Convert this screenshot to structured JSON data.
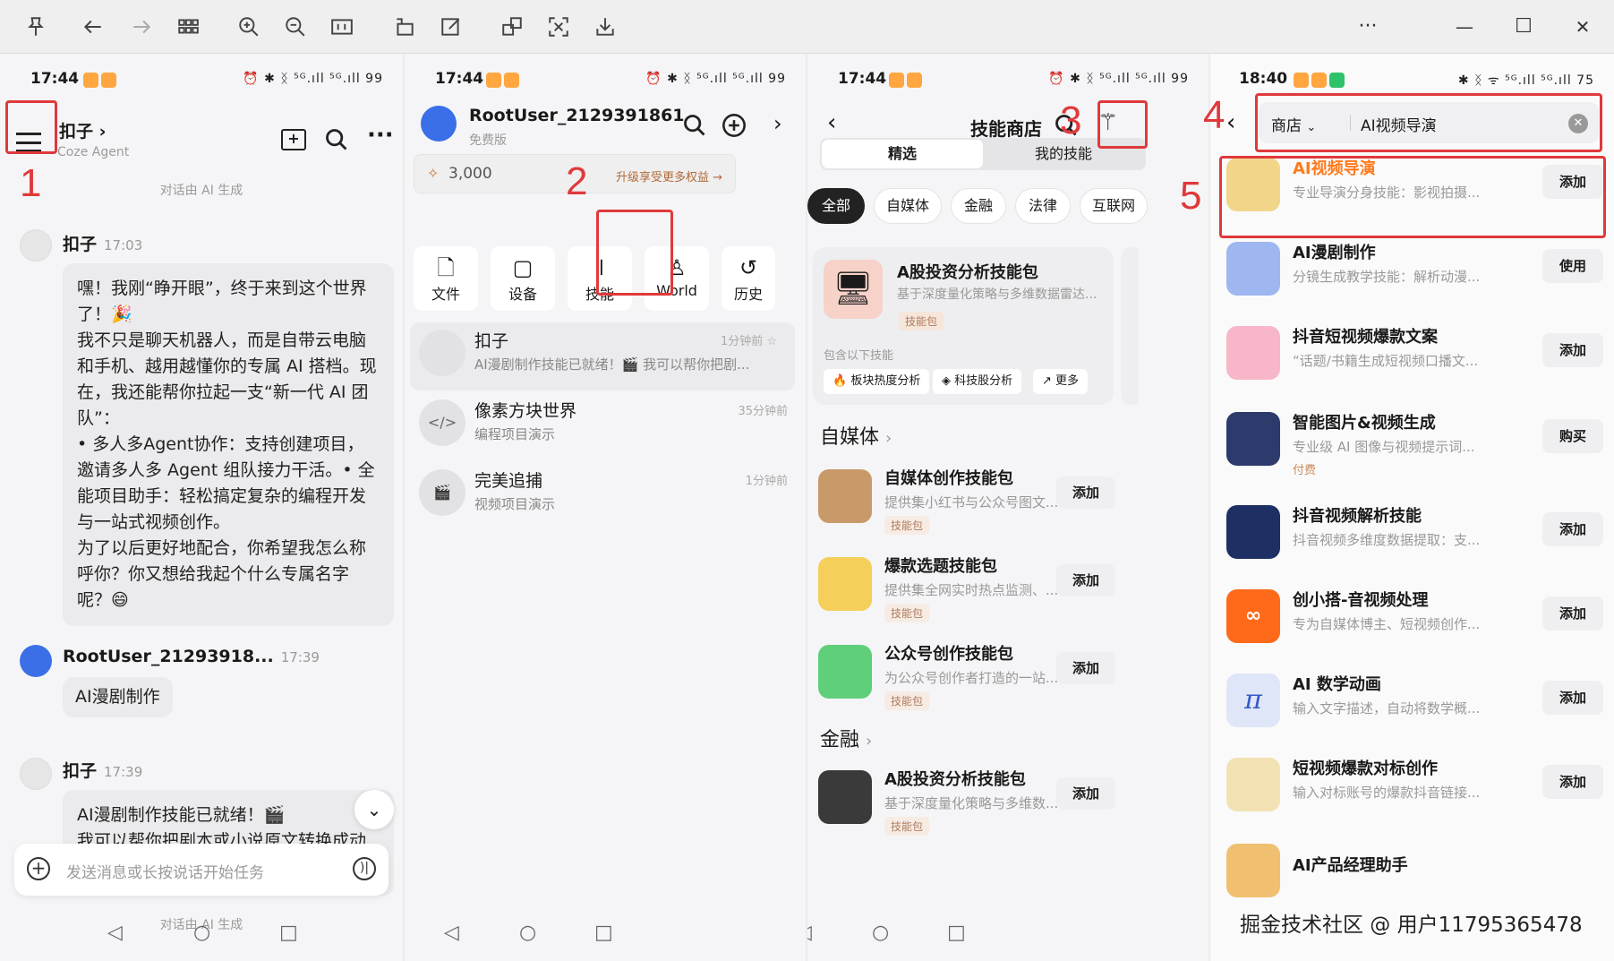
{
  "toolbar": {
    "more": "···",
    "min": "—",
    "max": "☐",
    "close": "✕"
  },
  "step_labels": [
    "1",
    "2",
    "3",
    "4",
    "5"
  ],
  "p1": {
    "time": "17:44",
    "status_icons": "⏰ ✱ ᛝ ⁵ᴳ.ıll ⁵ᴳ.ıll 99",
    "agent_name": "扣子",
    "agent_chev": "›",
    "agent_sub": "Coze Agent",
    "ai_gen": "对话由 AI 生成",
    "msg1_sender": "扣子",
    "msg1_time": "17:03",
    "msg1_text": "嘿！我刚“睁开眼”，终于来到这个世界了！🎉\n我不只是聊天机器人，而是自带云电脑和手机、越用越懂你的专属 AI 搭档。现在，我还能帮你拉起一支“新一代 AI 团队”：\n• 多人多Agent协作：支持创建项目，邀请多人多 Agent 组队接力干活。• 全能项目助手：轻松搞定复杂的编程开发与一站式视频创作。\n为了以后更好地配合，你希望我怎么称呼你？你又想给我起个什么专属名字呢？😄",
    "msg2_sender": "RootUser_21293918...",
    "msg2_time": "17:39",
    "msg2_text": "AI漫剧制作",
    "msg3_sender": "扣子",
    "msg3_time": "17:39",
    "msg3_text": "AI漫剧制作技能已就绪！🎬\n我可以帮你把剧本或小说原文转换成动",
    "input_placeholder": "发送消息或长按说话开始任务",
    "ai_gen_bottom": "对话由 AI 生成"
  },
  "p2": {
    "time": "17:44",
    "status_icons": "⏰ ✱ ᛝ ⁵ᴳ.ıll ⁵ᴳ.ıll 99",
    "user": "RootUser_2129391861",
    "plan": "免费版",
    "points": "3,000",
    "upgrade": "升级享受更多权益 →",
    "buttons": [
      {
        "label": "文件",
        "icon": "🗋"
      },
      {
        "label": "设备",
        "icon": "▢"
      },
      {
        "label": "技能",
        "icon": "𝍪"
      },
      {
        "label": "World",
        "icon": "♙"
      },
      {
        "label": "历史",
        "icon": "↺"
      }
    ],
    "rows": [
      {
        "title": "扣子",
        "sub": "AI漫剧制作技能已就绪！🎬 我可以帮你把剧...",
        "time": "1分钟前 ☆"
      },
      {
        "title": "像素方块世界",
        "sub": "编程项目演示",
        "time": "35分钟前"
      },
      {
        "title": "完美追捕",
        "sub": "视频项目演示",
        "time": "1分钟前"
      }
    ]
  },
  "p3": {
    "time": "17:44",
    "status_icons": "⏰ ✱ ᛝ ⁵ᴳ.ıll ⁵ᴳ.ıll 99",
    "title": "技能商店",
    "seg": [
      "精选",
      "我的技能"
    ],
    "chips": [
      "全部",
      "自媒体",
      "金融",
      "法律",
      "互联网"
    ],
    "featured": {
      "title": "A股投资分析技能包",
      "desc": "基于深度量化策略与多维数据雷达...",
      "tag": "技能包",
      "includes": "包含以下技能",
      "items": [
        "板块热度分析",
        "科技股分析",
        "更多"
      ]
    },
    "sec1": "自媒体",
    "sec2": "金融",
    "rows": [
      {
        "title": "自媒体创作技能包",
        "desc": "提供集小红书与公众号图文...",
        "tag": "技能包",
        "btn": "添加",
        "color": "#c89a6a"
      },
      {
        "title": "爆款选题技能包",
        "desc": "提供集全网实时热点监测、...",
        "tag": "技能包",
        "btn": "添加",
        "color": "#f4cf5b"
      },
      {
        "title": "公众号创作技能包",
        "desc": "为公众号创作者打造的一站...",
        "tag": "技能包",
        "btn": "添加",
        "color": "#5fcf7a"
      },
      {
        "title": "A股投资分析技能包",
        "desc": "基于深度量化策略与多维数...",
        "tag": "技能包",
        "btn": "添加",
        "color": "#3a3a3a"
      }
    ]
  },
  "p4": {
    "time": "18:40",
    "status_icons": "✱ ᛝ ᯤ ⁵ᴳ.ıll ⁵ᴳ.ıll 75",
    "scope": "商店",
    "query": "AI视频导演",
    "rows": [
      {
        "title": "AI视频导演",
        "desc": "专业导演分身技能：影视拍摄...",
        "btn": "添加",
        "color": "#f1d68a",
        "highlight": true
      },
      {
        "title": "AI漫剧制作",
        "desc": "分镜生成教学技能：解析动漫...",
        "btn": "使用",
        "color": "#9fb7f0"
      },
      {
        "title": "抖音短视频爆款文案",
        "desc": "“话题/书籍生成短视频口播文...",
        "btn": "添加",
        "color": "#f7b7c8"
      },
      {
        "title": "智能图片&视频生成",
        "desc": "专业级 AI 图像与视频提示词...",
        "btn": "购买",
        "color": "#2c3b6b",
        "tag": "付费"
      },
      {
        "title": "抖音视频解析技能",
        "desc": "抖音视频多维度数据提取：支...",
        "btn": "添加",
        "color": "#1e2f63"
      },
      {
        "title": "创小搭-音视频处理",
        "desc": "专为自媒体博主、短视频创作...",
        "btn": "添加",
        "color": "#ff6a1a"
      },
      {
        "title": "AI 数学动画",
        "desc": "输入文字描述，自动将数学概...",
        "btn": "添加",
        "color": "#dfe6f7"
      },
      {
        "title": "短视频爆款对标创作",
        "desc": "输入对标账号的爆款抖音链接...",
        "btn": "添加",
        "color": "#f2e2b3"
      },
      {
        "title": "AI产品经理助手",
        "desc": "",
        "btn": "",
        "color": "#f0c070"
      }
    ]
  },
  "watermark": "掘金技术社区 @ 用户11795365478"
}
